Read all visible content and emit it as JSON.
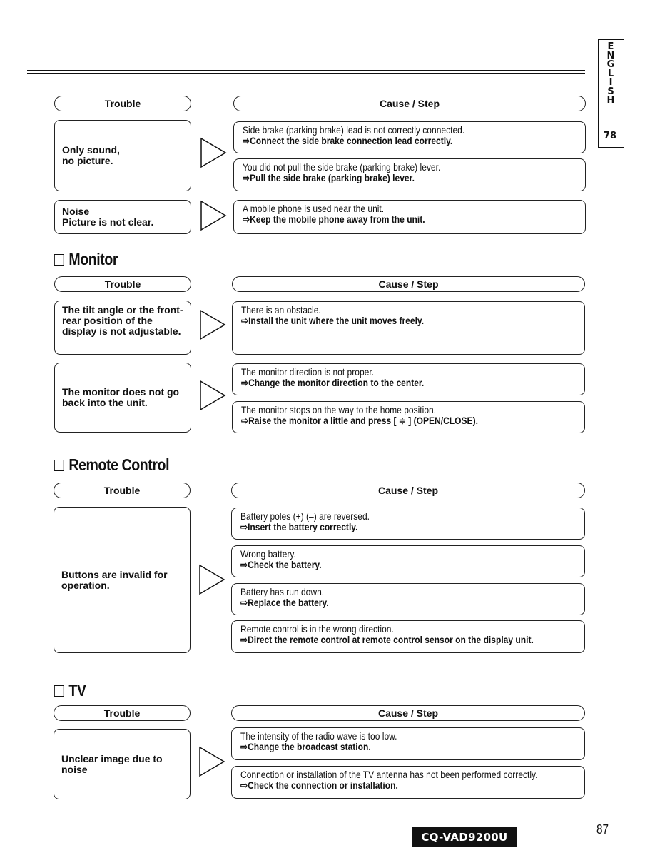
{
  "language_tab": {
    "letters": [
      "E",
      "N",
      "G",
      "L",
      "I",
      "S",
      "H"
    ],
    "page": "78"
  },
  "sections": [
    {
      "title": "",
      "headers": {
        "trouble": "Trouble",
        "cause": "Cause / Step"
      },
      "rows": [
        {
          "trouble": "Only sound,\nno picture.",
          "causes": [
            {
              "cause": "Side brake (parking brake) lead is not correctly connected.",
              "step": "⇨Connect the side brake connection lead correctly."
            },
            {
              "cause": "You did not pull the side brake (parking brake) lever.",
              "step": "⇨Pull the side brake (parking brake) lever."
            }
          ]
        },
        {
          "trouble": "Noise\nPicture is not clear.",
          "causes": [
            {
              "cause": "A mobile phone is used near the unit.",
              "step": "⇨Keep the mobile phone away from the unit."
            }
          ]
        }
      ]
    },
    {
      "title": "Monitor",
      "headers": {
        "trouble": "Trouble",
        "cause": "Cause / Step"
      },
      "rows": [
        {
          "trouble": "The tilt angle or the front-rear position of the display is not adjustable.",
          "causes": [
            {
              "cause": "There is an obstacle.",
              "step": "⇨Install the unit where the unit moves freely."
            }
          ]
        },
        {
          "trouble": "The monitor does not go back into the unit.",
          "causes": [
            {
              "cause": "The monitor direction is not proper.",
              "step": "⇨Change the monitor direction to the center."
            },
            {
              "cause": "The monitor stops on the way to the home position.",
              "step": "⇨Raise the monitor a little and press [ ≑ ] (OPEN/CLOSE)."
            }
          ]
        }
      ]
    },
    {
      "title": "Remote Control",
      "headers": {
        "trouble": "Trouble",
        "cause": "Cause / Step"
      },
      "rows": [
        {
          "trouble": "Buttons are invalid for operation.",
          "causes": [
            {
              "cause": "Battery poles (+) (–) are reversed.",
              "step": "⇨Insert the battery correctly."
            },
            {
              "cause": "Wrong battery.",
              "step": "⇨Check the battery."
            },
            {
              "cause": "Battery has run down.",
              "step": "⇨Replace the battery."
            },
            {
              "cause": "Remote control is in the wrong direction.",
              "step": "⇨Direct the remote control at remote control sensor on the display unit."
            }
          ]
        }
      ]
    },
    {
      "title": "TV",
      "headers": {
        "trouble": "Trouble",
        "cause": "Cause / Step"
      },
      "rows": [
        {
          "trouble": "Unclear image due to noise",
          "causes": [
            {
              "cause": "The intensity of the radio wave is too low.",
              "step": "⇨Change the broadcast station."
            },
            {
              "cause": "Connection or installation of the TV antenna has not been performed correctly.",
              "step": "⇨Check the connection or installation."
            }
          ]
        }
      ]
    }
  ],
  "footer": {
    "model": "CQ-VAD9200U",
    "page_number": "87"
  }
}
